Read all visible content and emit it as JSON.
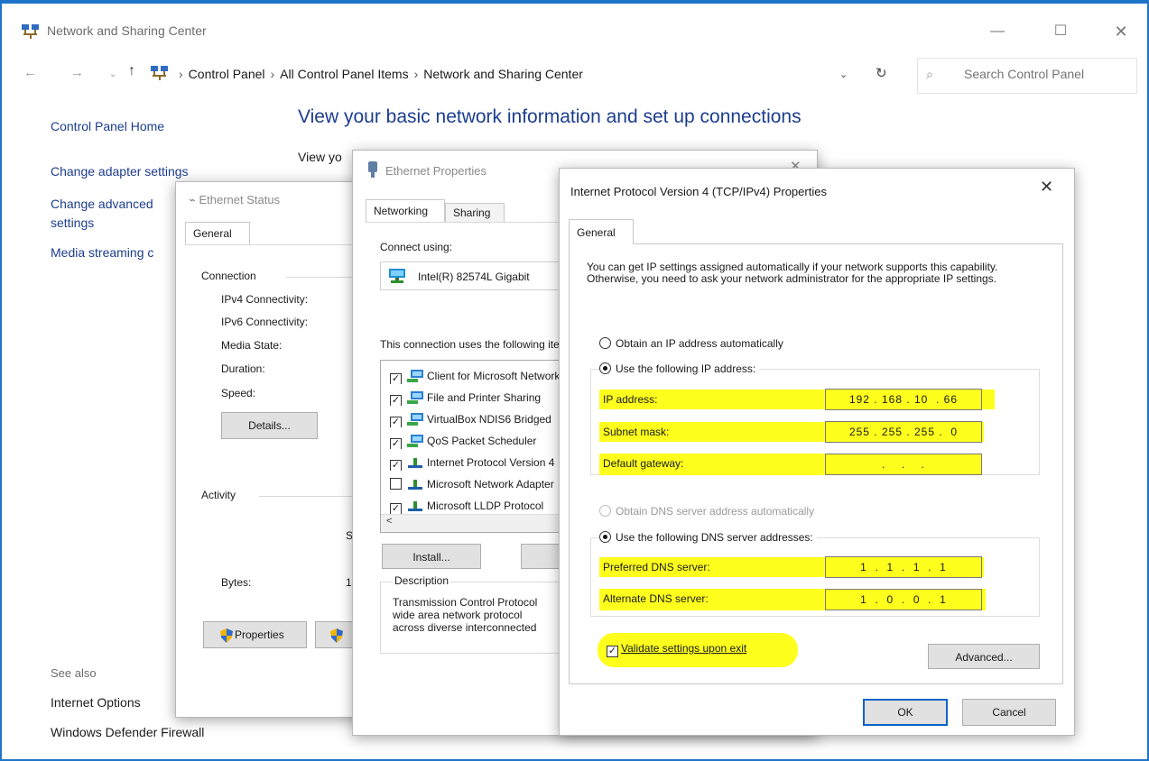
{
  "window": {
    "title": "Network and Sharing Center",
    "controls": {
      "minimize": "—",
      "maximize": "☐",
      "close": "✕"
    }
  },
  "address": {
    "breadcrumb": [
      "Control Panel",
      "All Control Panel Items",
      "Network and Sharing Center"
    ],
    "search_placeholder": "Search Control Panel"
  },
  "nav": {
    "home": "Control Panel Home",
    "adapter": "Change adapter settings",
    "advanced": "Change advanced settings",
    "media": "Media streaming c",
    "see_also": "See also",
    "internet_options": "Internet Options",
    "firewall": "Windows Defender Firewall"
  },
  "main": {
    "heading": "View your basic network information and set up connections",
    "view_your": "View yo"
  },
  "status_dialog": {
    "title": "Ethernet Status",
    "tab": "General",
    "connection": "Connection",
    "ipv4": "IPv4 Connectivity:",
    "ipv6": "IPv6 Connectivity:",
    "media": "Media State:",
    "duration": "Duration:",
    "speed": "Speed:",
    "details": "Details...",
    "activity": "Activity",
    "sent_partial": "S",
    "bytes": "Bytes:",
    "bytes_partial": "1",
    "properties": "Properties"
  },
  "props_dialog": {
    "title": "Ethernet Properties",
    "close": "✕",
    "tabs": [
      "Networking",
      "Sharing"
    ],
    "connect_using": "Connect using:",
    "adapter": "Intel(R) 82574L Gigabit",
    "uses": "This connection uses the following items:",
    "items": [
      {
        "label": "Client for Microsoft Networks",
        "checked": true
      },
      {
        "label": "File and Printer Sharing",
        "checked": true
      },
      {
        "label": "VirtualBox NDIS6 Bridged",
        "checked": true
      },
      {
        "label": "QoS Packet Scheduler",
        "checked": true
      },
      {
        "label": "Internet Protocol Version 4",
        "checked": true
      },
      {
        "label": "Microsoft Network Adapter",
        "checked": false
      },
      {
        "label": "Microsoft LLDP Protocol",
        "checked": true
      }
    ],
    "install": "Install...",
    "description_label": "Description",
    "description_lines": [
      "Transmission Control Protocol",
      "wide area network protocol",
      "across diverse interconnected"
    ]
  },
  "ipv4_dialog": {
    "title": "Internet Protocol Version 4 (TCP/IPv4) Properties",
    "close": "✕",
    "tab": "General",
    "info": "You can get IP settings assigned automatically if your network supports this capability. Otherwise, you need to ask your network administrator for the appropriate IP settings.",
    "obtain_ip_auto": "Obtain an IP address automatically",
    "use_following_ip": "Use the following IP address:",
    "ip_label": "IP address:",
    "ip_value": "192 . 168 . 10  . 66",
    "mask_label": "Subnet mask:",
    "mask_value": "255 . 255 . 255 .  0",
    "gateway_label": "Default gateway:",
    "gateway_value": "  .    .    .  ",
    "obtain_dns_auto": "Obtain DNS server address automatically",
    "use_following_dns": "Use the following DNS server addresses:",
    "pdns_label": "Preferred DNS server:",
    "pdns_value": "1  .  1  .  1  .  1",
    "adns_label": "Alternate DNS server:",
    "adns_value": "1  .  0  .  0  .  1",
    "validate": "Validate settings upon exit",
    "advanced": "Advanced...",
    "ok": "OK",
    "cancel": "Cancel"
  },
  "colors": {
    "highlight": "#ffff1e",
    "link": "#1c3d8f",
    "window_border": "#1e74c9"
  },
  "icons": {
    "app": "network-sharing-icon",
    "search": "search-icon",
    "refresh": "refresh-icon"
  }
}
